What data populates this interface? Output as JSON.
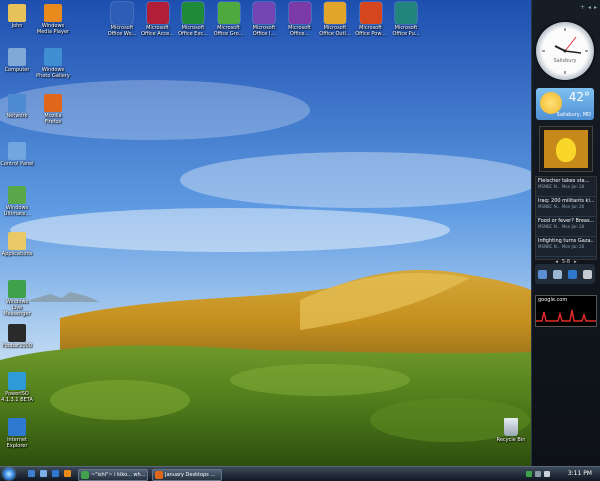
{
  "desktop": {
    "left_icons": [
      {
        "label": "John",
        "name": "user-folder-icon",
        "color": "#e7c25a"
      },
      {
        "label": "Computer",
        "name": "computer-icon",
        "color": "#7fa9d6"
      },
      {
        "label": "Network",
        "name": "network-icon",
        "color": "#4e8ad1"
      },
      {
        "label": "Control Panel",
        "name": "control-panel-icon",
        "color": "#6fa7de"
      },
      {
        "label": "Windows Ultimate...",
        "name": "windows-ultimate-icon",
        "color": "#58a84a"
      },
      {
        "label": "Applications",
        "name": "applications-folder-icon",
        "color": "#e9c867"
      },
      {
        "label": "Windows Live Messenger",
        "name": "messenger-icon",
        "color": "#3fa14a"
      },
      {
        "label": "Foobar2000",
        "name": "foobar-icon",
        "color": "#2a2a2a"
      },
      {
        "label": "PowerISO 4.1.3.1 BETA",
        "name": "poweriso-icon",
        "color": "#2d9bd8"
      },
      {
        "label": "Internet Explorer",
        "name": "internet-explorer-icon",
        "color": "#2f78cf"
      }
    ],
    "second_col_icons": [
      {
        "label": "Windows Media Player",
        "name": "media-player-icon",
        "color": "#e88a1c"
      },
      {
        "label": "Windows Photo Gallery",
        "name": "photo-gallery-icon",
        "color": "#3f8fd2"
      },
      {
        "label": "Mozilla Firefox",
        "name": "firefox-icon",
        "color": "#e0661c"
      }
    ],
    "top_icons": [
      {
        "label": "Microsoft Office Wo...",
        "name": "word-icon",
        "color": "#2c5eb5"
      },
      {
        "label": "Microsoft Office Acce...",
        "name": "access-icon",
        "color": "#b11e37"
      },
      {
        "label": "Microsoft Office Exc...",
        "name": "excel-icon",
        "color": "#1f8a3a"
      },
      {
        "label": "Microsoft Office Gro...",
        "name": "groove-icon",
        "color": "#4ea93e"
      },
      {
        "label": "Microsoft Office I...",
        "name": "infopath-icon",
        "color": "#7245b3"
      },
      {
        "label": "Microsoft Office...",
        "name": "onenote-icon",
        "color": "#7a3aa8"
      },
      {
        "label": "Microsoft Office Outl...",
        "name": "outlook-icon",
        "color": "#e0a52a"
      },
      {
        "label": "Microsoft Office Pow...",
        "name": "powerpoint-icon",
        "color": "#d5461e"
      },
      {
        "label": "Microsoft Office Pu...",
        "name": "publisher-icon",
        "color": "#21857e"
      }
    ],
    "recycle_bin": {
      "label": "Recycle Bin"
    }
  },
  "sidebar": {
    "clock_city": "Salisbury",
    "weather": {
      "temp": "42°",
      "location": "Salisbury, MD"
    },
    "feeds": [
      {
        "title": "Fleischer takes sta...",
        "source": "MSNBC N...",
        "date": "Mon Jan 28"
      },
      {
        "title": "Iraq: 200 militants ki...",
        "source": "MSNBC N...",
        "date": "Mon Jan 28"
      },
      {
        "title": "Food or fever? Breas...",
        "source": "MSNBC N...",
        "date": "Mon Jan 28"
      },
      {
        "title": "Infighting turns Gaza...",
        "source": "MSNBC N...",
        "date": "Mon Jan 28"
      }
    ],
    "feed_page": "5-8",
    "perf_title": "google.com"
  },
  "taskbar": {
    "buttons": [
      {
        "label": "~\"ishi\"~ i kiko... wh...",
        "name": "taskbar-messenger-button",
        "color": "#3fa14a"
      },
      {
        "label": "January Desktops ...",
        "name": "taskbar-firefox-button",
        "color": "#e0661c"
      }
    ],
    "time": "3:11 PM"
  }
}
